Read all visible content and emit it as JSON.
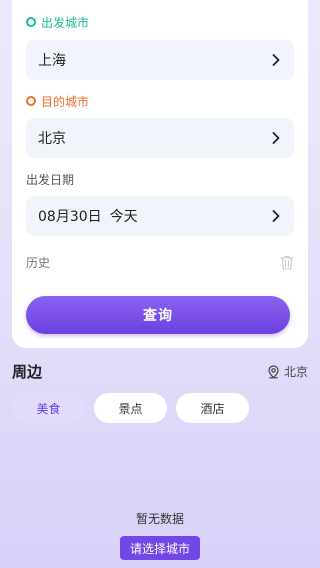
{
  "search": {
    "from_label": "出发城市",
    "from_value": "上海",
    "to_label": "目的城市",
    "to_value": "北京",
    "date_label": "出发日期",
    "date_value": "08月30日",
    "date_day": "今天",
    "history_label": "历史",
    "query_button": "查询"
  },
  "nearby": {
    "title": "周边",
    "city": "北京",
    "tabs": [
      {
        "label": "美食",
        "active": true
      },
      {
        "label": "景点",
        "active": false
      },
      {
        "label": "酒店",
        "active": false
      }
    ]
  },
  "empty": {
    "message": "暂无数据",
    "button": "请选择城市"
  },
  "colors": {
    "accent": "#6c3fe0",
    "from_dot": "#1fb9a0",
    "to_dot": "#f06d2a"
  },
  "icons": [
    "chevron-right-icon",
    "trash-icon",
    "location-icon"
  ]
}
